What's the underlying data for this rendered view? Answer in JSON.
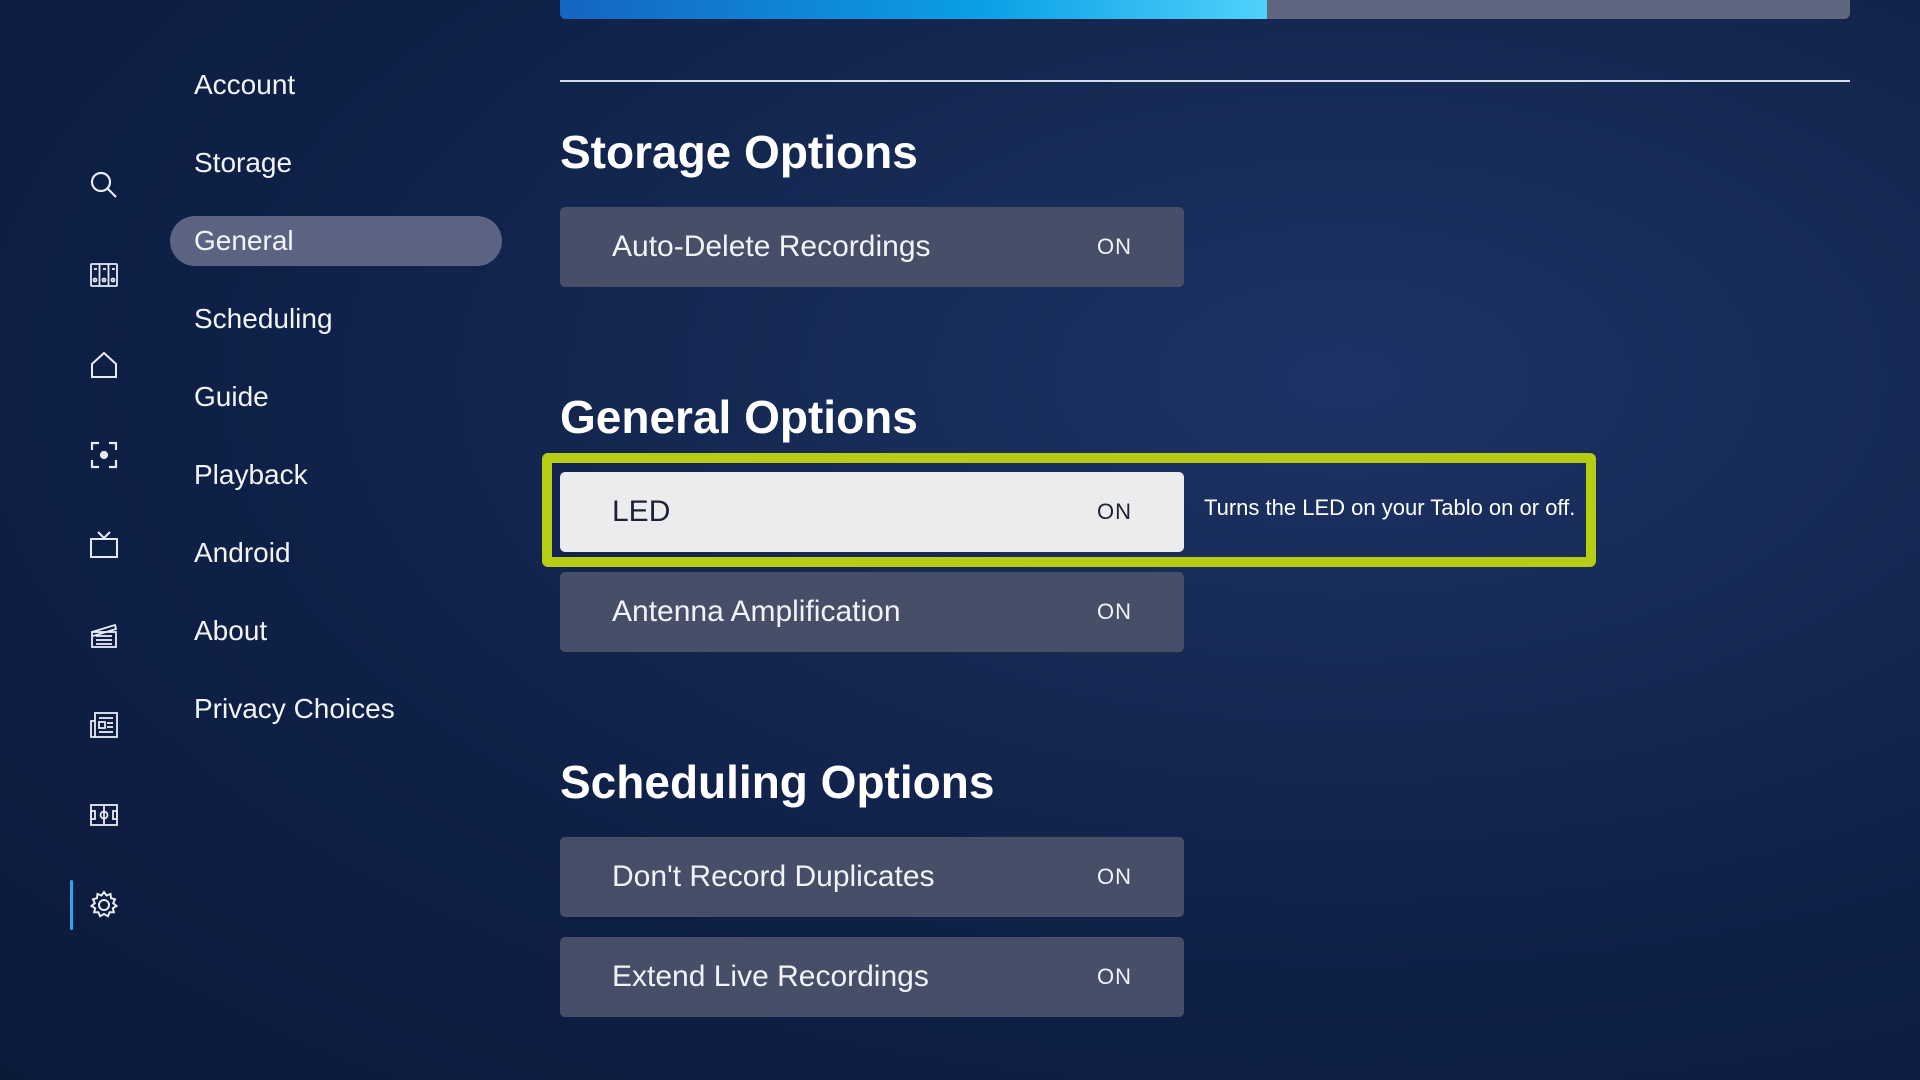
{
  "progress": {
    "fraction": 0.548
  },
  "rail": {
    "items": [
      {
        "icon": "search-icon",
        "name": "rail-search"
      },
      {
        "icon": "grid-icon",
        "name": "rail-guide"
      },
      {
        "icon": "home-icon",
        "name": "rail-home"
      },
      {
        "icon": "focus-icon",
        "name": "rail-live"
      },
      {
        "icon": "tv-icon",
        "name": "rail-shows"
      },
      {
        "icon": "clapperboard-icon",
        "name": "rail-movies"
      },
      {
        "icon": "news-icon",
        "name": "rail-news"
      },
      {
        "icon": "sports-field-icon",
        "name": "rail-sports"
      },
      {
        "icon": "gear-icon",
        "name": "rail-settings"
      }
    ],
    "active": "rail-settings"
  },
  "menu": {
    "items": [
      {
        "label": "Account"
      },
      {
        "label": "Storage"
      },
      {
        "label": "General",
        "active": true
      },
      {
        "label": "Scheduling"
      },
      {
        "label": "Guide"
      },
      {
        "label": "Playback"
      },
      {
        "label": "Android"
      },
      {
        "label": "About"
      },
      {
        "label": "Privacy Choices"
      }
    ]
  },
  "sections": {
    "storage": {
      "title": "Storage Options",
      "options": [
        {
          "label": "Auto-Delete Recordings",
          "value": "ON"
        }
      ]
    },
    "general": {
      "title": "General Options",
      "options": [
        {
          "label": "LED",
          "value": "ON",
          "focused": true,
          "hint": "Turns the LED on your Tablo on or off."
        },
        {
          "label": "Antenna Amplification",
          "value": "ON"
        }
      ]
    },
    "scheduling": {
      "title": "Scheduling Options",
      "options": [
        {
          "label": "Don't Record Duplicates",
          "value": "ON"
        },
        {
          "label": "Extend Live Recordings",
          "value": "ON"
        }
      ]
    }
  },
  "colors": {
    "focus_outline": "#b6cd14",
    "active_menu_bg": "#5a6482",
    "option_bg": "#474f68",
    "progress_fill": "#0aa0e6"
  }
}
